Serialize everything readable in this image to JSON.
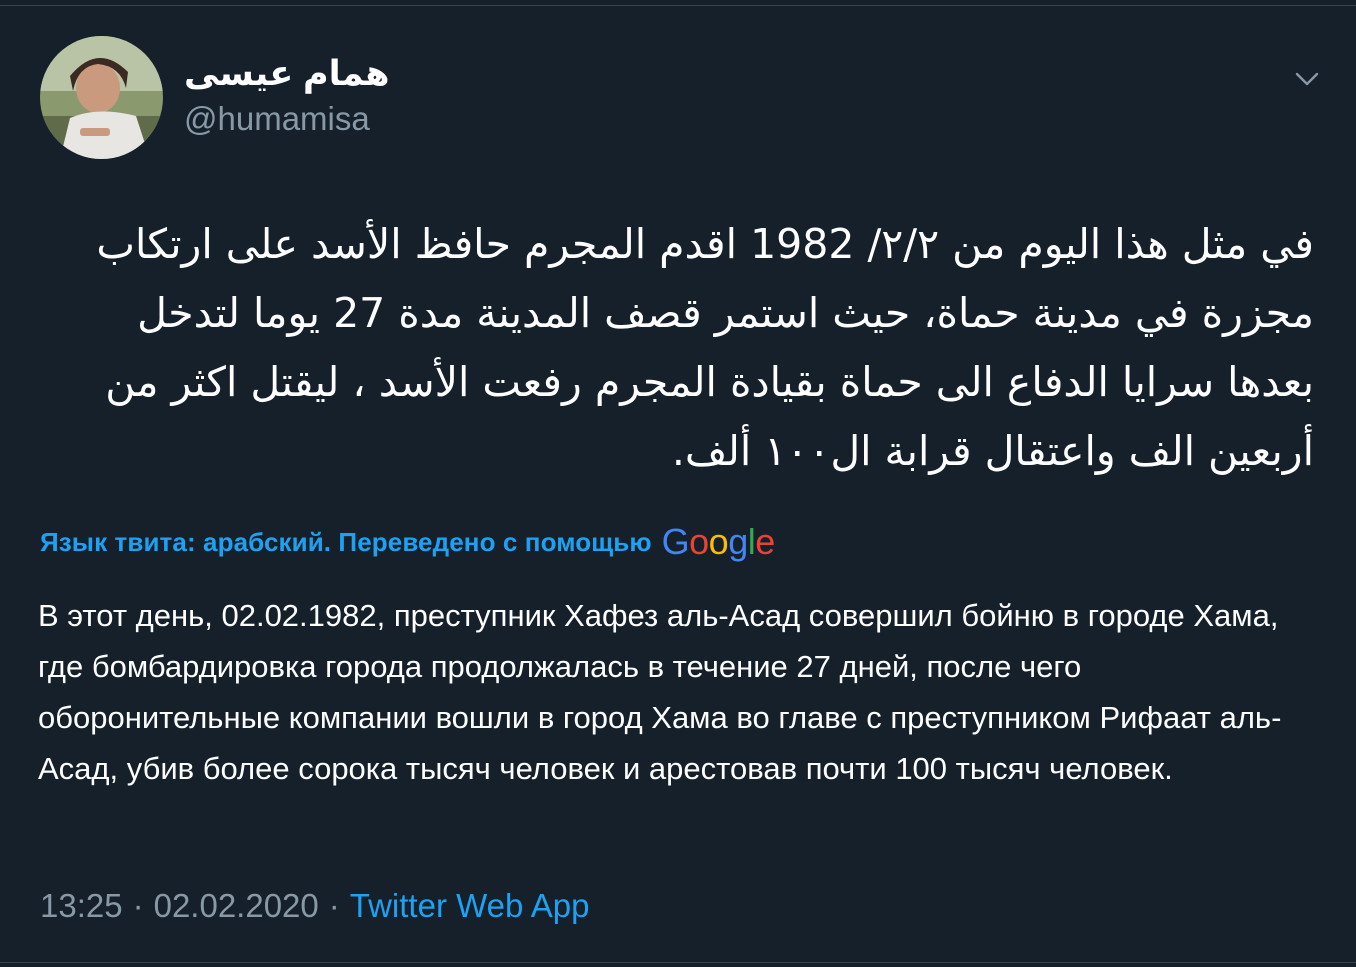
{
  "tweet": {
    "display_name": "همام عيسى",
    "handle": "@humamisa",
    "text_ar": "في مثل هذا اليوم من ٢/٢/ 1982 اقدم المجرم حافظ الأسد على ارتكاب مجزرة في مدينة حماة، حيث استمر قصف المدينة مدة 27 يوما لتدخل بعدها سرايا الدفاع الى حماة بقيادة المجرم رفعت الأسد ، ليقتل اكثر من أربعين الف واعتقال قرابة ال١٠٠ ألف.",
    "translation_label": "Язык твита: арабский. Переведено с помощью",
    "translation_provider": "Google",
    "text_ru": "В этот день, 02.02.1982, преступник Хафез аль-Асад совершил бойню в городе Хама, где бомбардировка города продолжалась в течение 27 дней, после чего оборонительные компании вошли в город Хама во главе с преступником Рифаат аль-Асад, убив более сорока тысяч человек и арестовав почти 100 тысяч человек.",
    "time": "13:25",
    "separator": "·",
    "date": "02.02.2020",
    "source": "Twitter Web App"
  },
  "colors": {
    "background": "#15202b",
    "primary_text": "#ffffff",
    "secondary_text": "#8899a6",
    "accent": "#1da1f2",
    "border": "#38444d"
  },
  "icons": {
    "menu": "chevron-down-icon"
  }
}
